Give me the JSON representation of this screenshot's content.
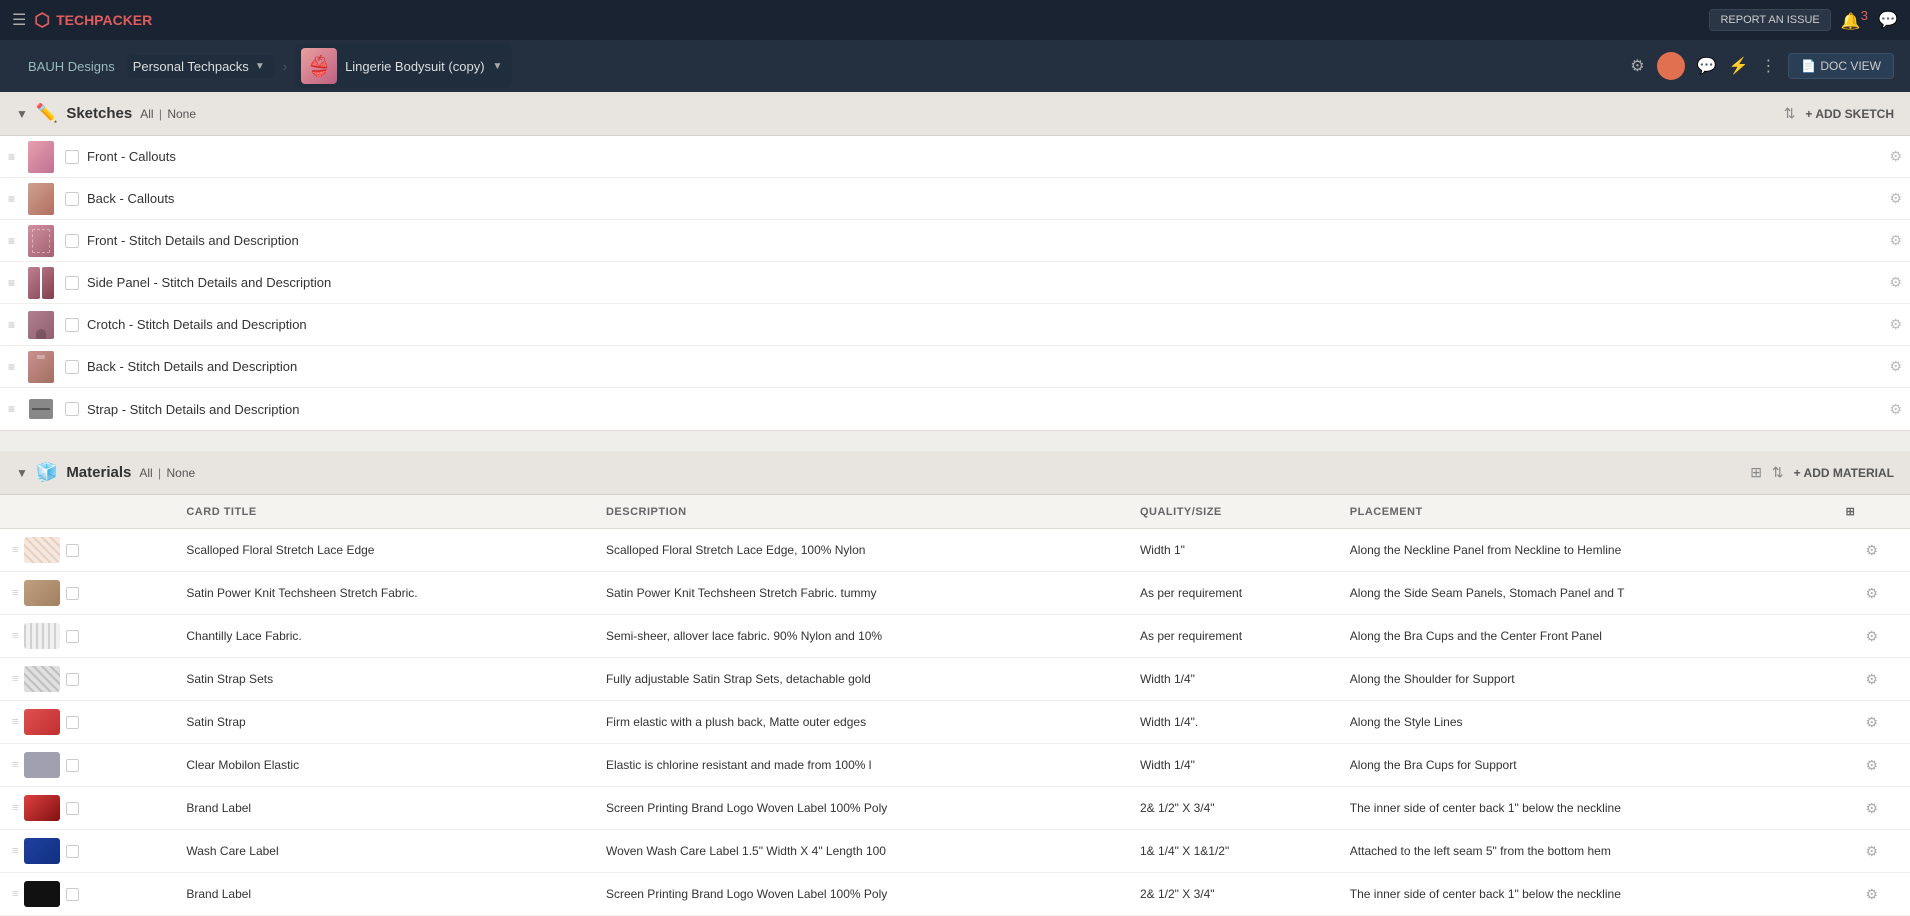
{
  "topNav": {
    "brand": "TECHPACKER",
    "reportIssue": "REPORT AN ISSUE",
    "notifCount": "3"
  },
  "secondNav": {
    "workspace": "BAUH Designs",
    "techpack": "Personal Techpacks",
    "product": "Lingerie Bodysuit (copy)",
    "docView": "DOC VIEW"
  },
  "sketches": {
    "title": "Sketches",
    "filterAll": "All",
    "filterNone": "None",
    "addLabel": "+ ADD SKETCH",
    "items": [
      {
        "label": "Front - Callouts",
        "thumbType": "front"
      },
      {
        "label": "Back - Callouts",
        "thumbType": "back"
      },
      {
        "label": "Front - Stitch Details and Description",
        "thumbType": "front2"
      },
      {
        "label": "Side Panel - Stitch Details and Description",
        "thumbType": "side"
      },
      {
        "label": "Crotch - Stitch Details and Description",
        "thumbType": "crotch"
      },
      {
        "label": "Back - Stitch Details and Description",
        "thumbType": "back2"
      },
      {
        "label": "Strap - Stitch Details and Description",
        "thumbType": "strap"
      }
    ]
  },
  "materials": {
    "title": "Materials",
    "filterAll": "All",
    "filterNone": "None",
    "addLabel": "+ ADD MATERIAL",
    "columns": [
      "Card Title",
      "DESCRIPTION",
      "QUALITY/SIZE",
      "PLACEMENT"
    ],
    "items": [
      {
        "thumbType": "lace",
        "title": "Scalloped Floral Stretch Lace Edge",
        "description": "Scalloped Floral Stretch Lace Edge, 100% Nylon",
        "quality": "Width 1\"",
        "placement": "Along the Neckline Panel from Neckline to Hemline"
      },
      {
        "thumbType": "knit",
        "title": "Satin Power Knit Techsheen Stretch Fabric.",
        "description": "Satin Power Knit Techsheen Stretch Fabric. tummy",
        "quality": "As per requirement",
        "placement": "Along the Side Seam Panels, Stomach Panel and T"
      },
      {
        "thumbType": "lace2",
        "title": "Chantilly Lace Fabric.",
        "description": "Semi-sheer, allover lace fabric. 90% Nylon and 10%",
        "quality": "As per requirement",
        "placement": "Along the Bra Cups and the Center Front Panel"
      },
      {
        "thumbType": "satin",
        "title": "Satin Strap Sets",
        "description": "Fully adjustable Satin Strap Sets, detachable gold",
        "quality": "Width 1/4\"",
        "placement": "Along the Shoulder for Support"
      },
      {
        "thumbType": "red",
        "title": "Satin Strap",
        "description": "Firm elastic with a plush back, Matte outer edges",
        "quality": "Width 1/4\".",
        "placement": "Along the Style Lines"
      },
      {
        "thumbType": "elastic",
        "title": "Clear Mobilon Elastic",
        "description": "Elastic is chlorine resistant and made from 100% l",
        "quality": "Width 1/4\"",
        "placement": "Along the Bra Cups for Support"
      },
      {
        "thumbType": "brand",
        "title": "Brand Label",
        "description": "Screen Printing Brand Logo Woven Label 100% Poly",
        "quality": "2& 1/2\"  X 3/4\"",
        "placement": "The inner side of center back 1\" below the neckline"
      },
      {
        "thumbType": "wash",
        "title": "Wash Care Label",
        "description": "Woven Wash Care Label 1.5\" Width X 4\" Length 100",
        "quality": "1& 1/4\" X 1&1/2\"",
        "placement": "Attached to the left seam 5\" from the bottom hem"
      },
      {
        "thumbType": "black",
        "title": "Brand Label",
        "description": "Screen Printing Brand Logo Woven Label 100% Poly",
        "quality": "2& 1/2\"  X 3/4\"",
        "placement": "The inner side of center back 1\" below the neckline"
      }
    ]
  }
}
